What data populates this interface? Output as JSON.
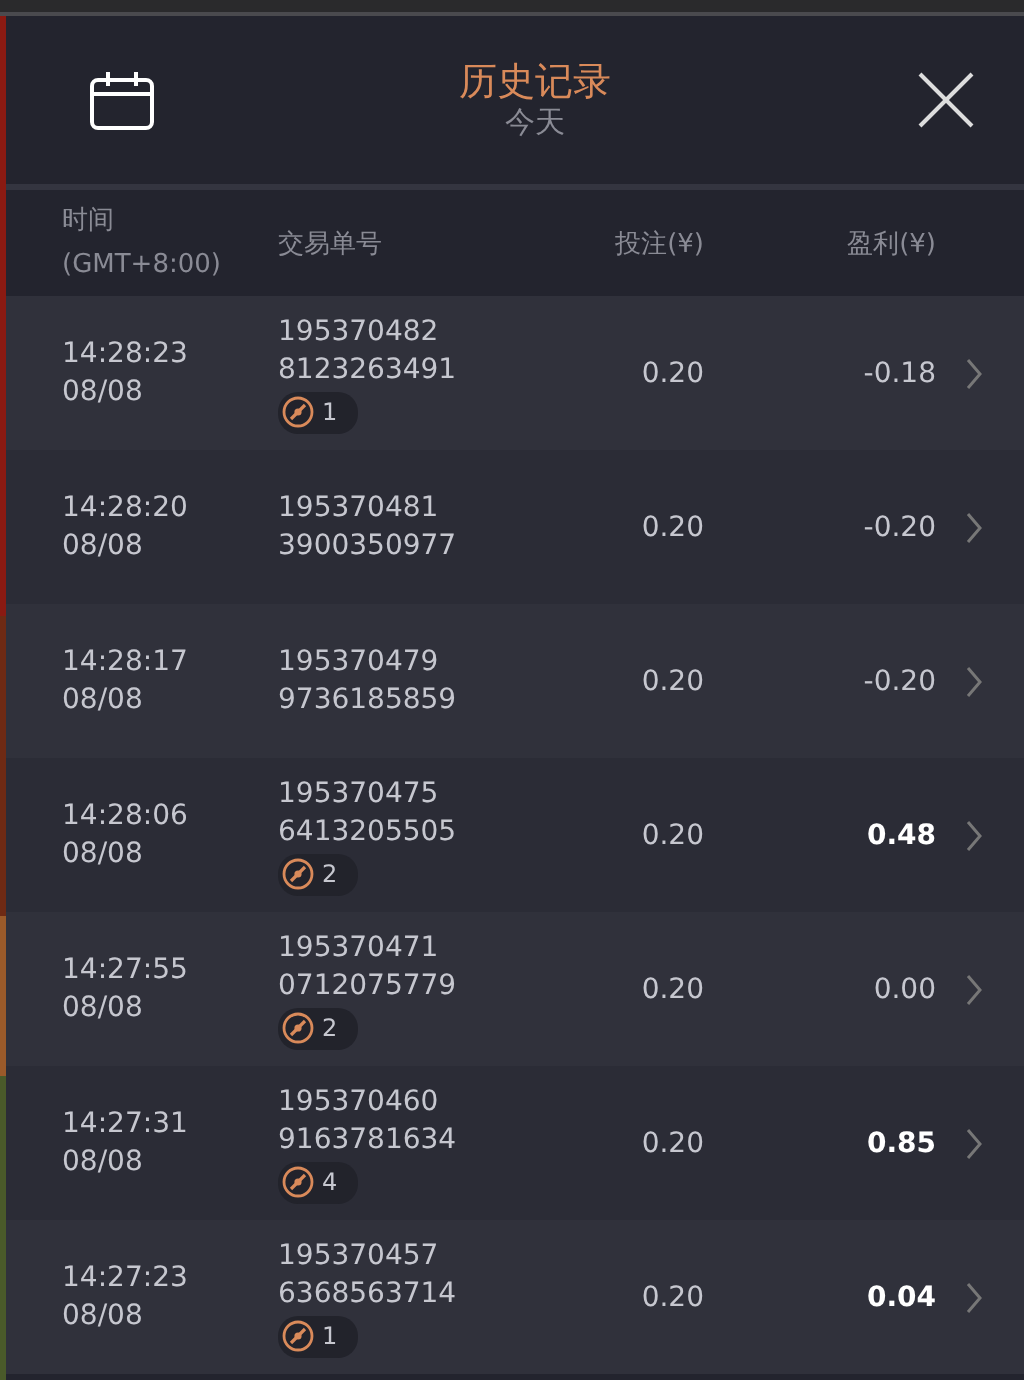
{
  "header": {
    "title": "历史记录",
    "subtitle": "今天"
  },
  "columns": {
    "time": [
      "时间",
      "(GMT+8:00)"
    ],
    "order": "交易单号",
    "bet": "投注(¥)",
    "profit": "盈利(¥)"
  },
  "rows": [
    {
      "time": "14:28:23",
      "date": "08/08",
      "order": [
        "195370482",
        "8123263491"
      ],
      "badge": "1",
      "bet": "0.20",
      "profit": "-0.18",
      "highlight": false
    },
    {
      "time": "14:28:20",
      "date": "08/08",
      "order": [
        "195370481",
        "3900350977"
      ],
      "bet": "0.20",
      "profit": "-0.20",
      "highlight": false
    },
    {
      "time": "14:28:17",
      "date": "08/08",
      "order": [
        "195370479",
        "9736185859"
      ],
      "bet": "0.20",
      "profit": "-0.20",
      "highlight": false
    },
    {
      "time": "14:28:06",
      "date": "08/08",
      "order": [
        "195370475",
        "6413205505"
      ],
      "badge": "2",
      "bet": "0.20",
      "profit": "0.48",
      "highlight": true
    },
    {
      "time": "14:27:55",
      "date": "08/08",
      "order": [
        "195370471",
        "0712075779"
      ],
      "badge": "2",
      "bet": "0.20",
      "profit": "0.00",
      "highlight": false
    },
    {
      "time": "14:27:31",
      "date": "08/08",
      "order": [
        "195370460",
        "9163781634"
      ],
      "badge": "4",
      "bet": "0.20",
      "profit": "0.85",
      "highlight": true
    },
    {
      "time": "14:27:23",
      "date": "08/08",
      "order": [
        "195370457",
        "6368563714"
      ],
      "badge": "1",
      "bet": "0.20",
      "profit": "0.04",
      "highlight": true
    }
  ]
}
